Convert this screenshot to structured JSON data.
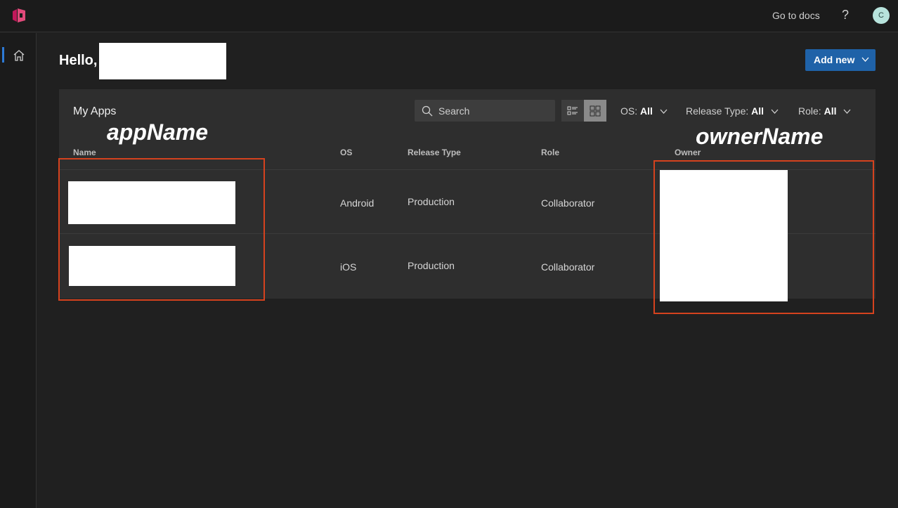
{
  "topbar": {
    "docs_label": "Go to docs",
    "help_label": "?",
    "avatar_initial": "C"
  },
  "header": {
    "greeting": "Hello,",
    "add_new_label": "Add new"
  },
  "card": {
    "title": "My Apps",
    "search_placeholder": "Search",
    "filters": [
      {
        "label": "OS:",
        "value": "All"
      },
      {
        "label": "Release Type:",
        "value": "All"
      },
      {
        "label": "Role:",
        "value": "All"
      }
    ],
    "columns": [
      "Name",
      "OS",
      "Release Type",
      "Role",
      "Owner"
    ],
    "rows": [
      {
        "os": "Android",
        "release_type": "Production",
        "role": "Collaborator"
      },
      {
        "os": "iOS",
        "release_type": "Production",
        "role": "Collaborator"
      }
    ]
  },
  "annotations": {
    "app_name_label": "appName",
    "owner_name_label": "ownerName",
    "box_color": "#d5421e"
  }
}
